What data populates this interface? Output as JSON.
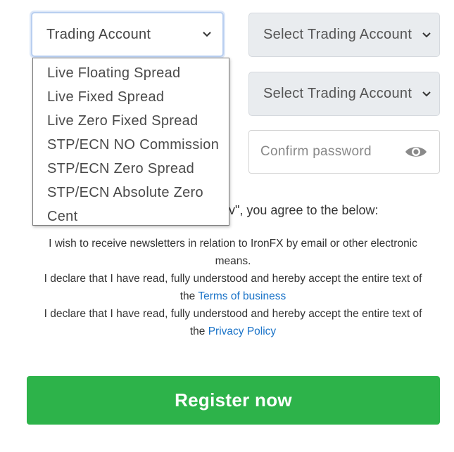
{
  "account_type_select": {
    "value": "Trading Account"
  },
  "trading_account_select_1": {
    "value": "Select Trading Account"
  },
  "trading_account_select_2": {
    "value": "Select Trading Account"
  },
  "confirm_password": {
    "placeholder": "Confirm password"
  },
  "dropdown": {
    "options": [
      "Live Floating Spread",
      "Live Fixed Spread",
      "Live Zero Fixed Spread",
      "STP/ECN NO Commission",
      "STP/ECN Zero Spread",
      "STP/ECN Absolute Zero",
      "Cent"
    ]
  },
  "agreement": {
    "intro_fragment": "v\", you agree to the below:",
    "newsletter": "I wish to receive newsletters in relation to IronFX by email or other electronic means.",
    "terms_prefix": "I declare that I have read, fully understood and hereby accept the entire text of the",
    "terms_link": "Terms of business",
    "privacy_prefix": "I declare that I have read, fully understood and hereby accept the entire text of the",
    "privacy_link": "Privacy Policy"
  },
  "register_button": {
    "label": "Register now"
  },
  "colors": {
    "accent_green": "#2db34a",
    "link_blue": "#1a73c8"
  }
}
